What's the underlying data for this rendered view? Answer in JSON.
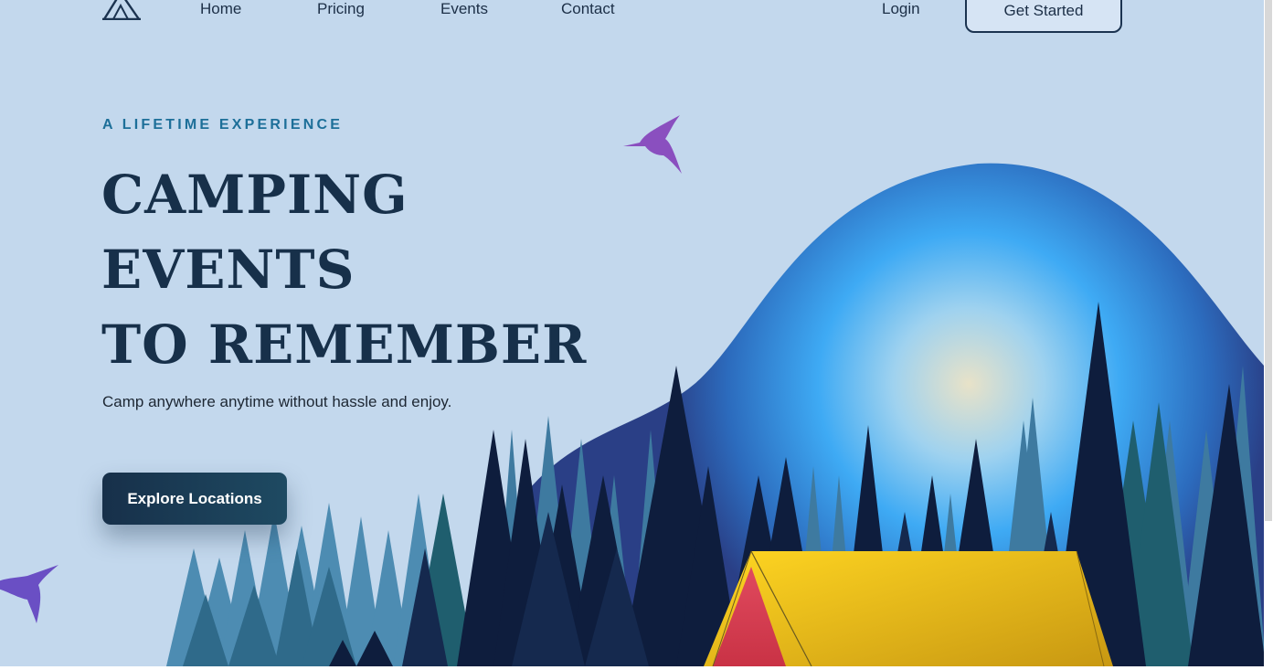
{
  "nav": {
    "links": [
      "Home",
      "Pricing",
      "Events",
      "Contact"
    ],
    "login": "Login",
    "get_started": "Get Started"
  },
  "hero": {
    "eyebrow": "A LIFETIME EXPERIENCE",
    "headline": [
      "CAMPING",
      "EVENTS",
      "TO REMEMBER"
    ],
    "subtitle": "Camp anywhere anytime without hassle and enjoy.",
    "cta": "Explore Locations"
  },
  "colors": {
    "background": "#c3d8ed",
    "text_dark": "#17304a",
    "accent": "#1d6f99",
    "bird": "#7d4fbf",
    "tent": "#f2c31a"
  }
}
